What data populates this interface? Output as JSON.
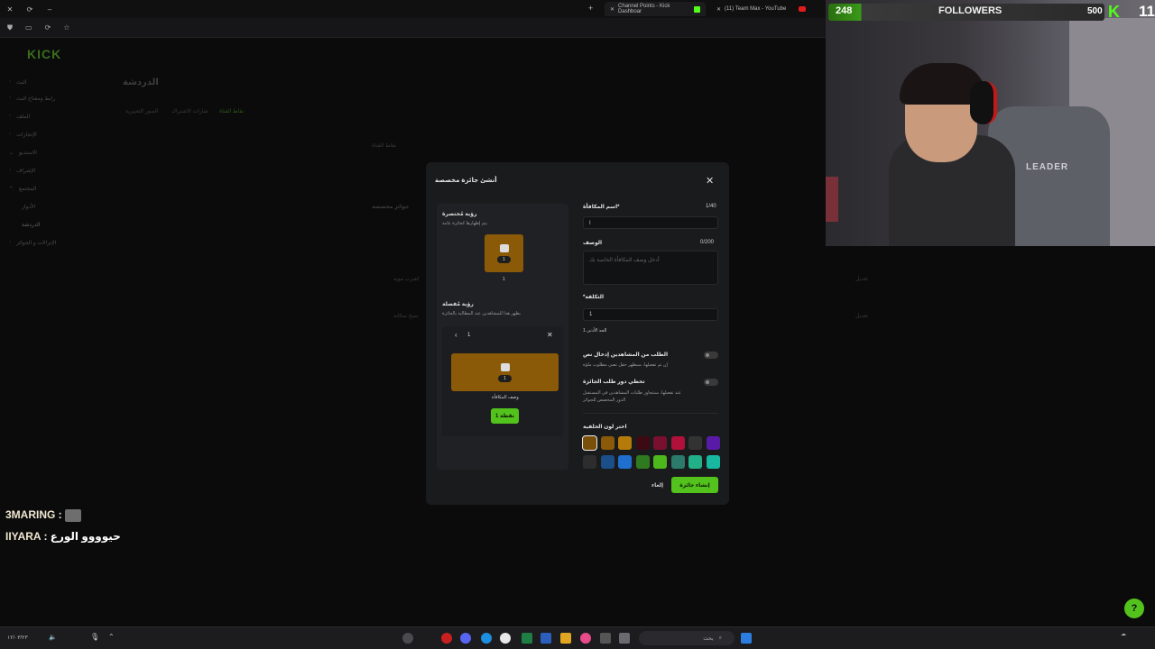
{
  "browser": {
    "tabs": [
      {
        "label": "Channel Points - Kick Dashboar"
      },
      {
        "label": "(11) Team Max - YouTube"
      }
    ]
  },
  "dashboard": {
    "logo": "KICK",
    "page_title": "الدردشة",
    "subtabs": [
      "نقاط القناة",
      "شارات الاشتراك",
      "الصور التعبيرية"
    ],
    "sidebar_items": [
      "البث",
      "رابط ومفتاح البث",
      "الملف",
      "الإنجازات",
      "الاستديو",
      "الإشراف",
      "المجتمع",
      "الأدوار",
      "الدردشة",
      "الإنزالات و الجوائز"
    ],
    "section_label": "نقاط القناة",
    "list_title": "جوائز مخصصة",
    "rows": [
      {
        "name": "اشرب مويه",
        "action": "تعديل"
      },
      {
        "name": "نسخ سكانه",
        "action": "تعديل"
      }
    ]
  },
  "modal": {
    "title": "أنشئ جائزة مخصصة",
    "compact_view": {
      "title": "رؤية مُختصرة",
      "subtitle": "يتم إظهارها كجائزة عامة",
      "cost": "1",
      "below": "1"
    },
    "detail_view": {
      "title": "رؤية مُفصلة",
      "subtitle": "يظهر هذا للمشاهدين عند المطالبة بالجائزة",
      "header_value": "1",
      "cost": "1",
      "desc_label": "وصف المكافأة",
      "button": "1 نقطة"
    },
    "fields": {
      "name_label": "اسم المكافأة*",
      "name_counter": "1/40",
      "name_value": "ا",
      "desc_label": "الوصف",
      "desc_counter": "0/200",
      "desc_placeholder": "أدخل وصف المكافأة الخاصة بك",
      "cost_label": "*التكلفة",
      "cost_value": "1",
      "cost_min": "الحد الأدنى 1"
    },
    "options": [
      {
        "title": "الطلب من المشاهدين إدخال نص",
        "desc": "إن تم تفعيلها، سيظهر حقل نصي مطلوب ملؤه"
      },
      {
        "title": "تخطي دور طلب الجائزة",
        "desc": "عند تفعيلها، ستتجاوز طلبات المشاهدين في المستقبل الدور المخصص للجوائز"
      }
    ],
    "color_label": "اختر لون الخلفية",
    "colors_row1": [
      "#7a4f0a",
      "#8a5a08",
      "#b57a0a",
      "#3d0a14",
      "#7a1030",
      "#b0103a",
      "#333333",
      "#5a1aa8"
    ],
    "colors_row2": [
      "#2d2d2d",
      "#1a4f8a",
      "#1f6fcf",
      "#2f7a1e",
      "#4cb81c",
      "#2b7a6a",
      "#22b089",
      "#18b8a0"
    ],
    "cancel": "إلغاء",
    "create": "إنشاء جائزة"
  },
  "stream": {
    "followers_count": "248",
    "followers_label": "FOLLOWERS",
    "followers_goal": "500",
    "badge_num": "11",
    "chair_text": "LEADER"
  },
  "chat": [
    {
      "user": "3MARING",
      "sep": " : ",
      "msg": ""
    },
    {
      "user": "IIYARA",
      "sep": " : ",
      "msg": "حيوووو الورع"
    }
  ],
  "taskbar": {
    "search_label": "بحث",
    "date_text": "١٢/٠٣/٢٣"
  }
}
